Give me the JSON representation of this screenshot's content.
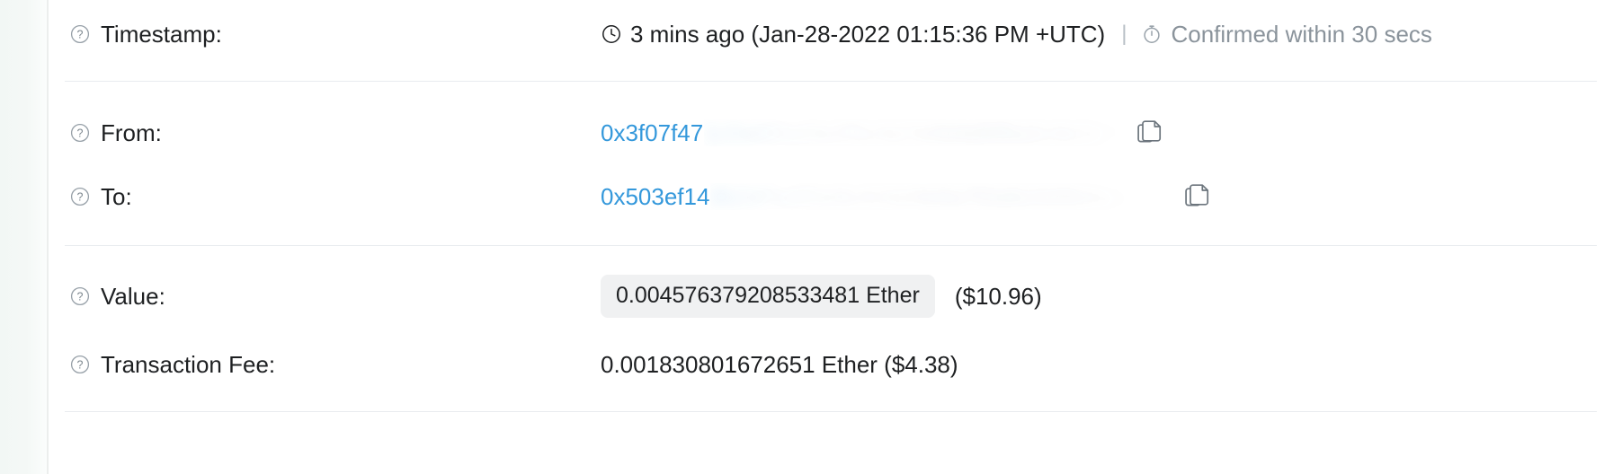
{
  "panel": {
    "rows": [
      {
        "key": "timestamp",
        "label": "Timestamp:",
        "help_icon": "question-circle-icon",
        "clock_icon": "clock-icon",
        "value": "3 mins ago (Jan-28-2022 01:15:36 PM +UTC)",
        "separator": "|",
        "stopwatch_icon": "stopwatch-icon",
        "confirmation": "Confirmed within 30 secs"
      },
      {
        "key": "from",
        "label": "From:",
        "help_icon": "question-circle-icon",
        "address_visible": "0x3f07f47",
        "address_redacted": "1c9a88bd3e2f5c4a7e0b9d6f8a2c4e1b7d",
        "copy_icon": "copy-icon"
      },
      {
        "key": "to",
        "label": "To:",
        "help_icon": "question-circle-icon",
        "address_visible": "0x503ef14",
        "address_redacted": "8b2d7a6f0e9c415d3b8a7f2e6c0d9b4a1e",
        "copy_icon": "copy-icon"
      },
      {
        "key": "value",
        "label": "Value:",
        "help_icon": "question-circle-icon",
        "amount": "0.004576379208533481 Ether",
        "usd": "($10.96)"
      },
      {
        "key": "transaction-fee",
        "label": "Transaction Fee:",
        "help_icon": "question-circle-icon",
        "fee": "0.001830801672651 Ether ($4.38)"
      }
    ]
  },
  "colors": {
    "link": "#3498db",
    "text": "#1e2022",
    "muted": "#8a939b",
    "chip_bg": "#f0f1f2",
    "divider": "#e9ecef"
  }
}
